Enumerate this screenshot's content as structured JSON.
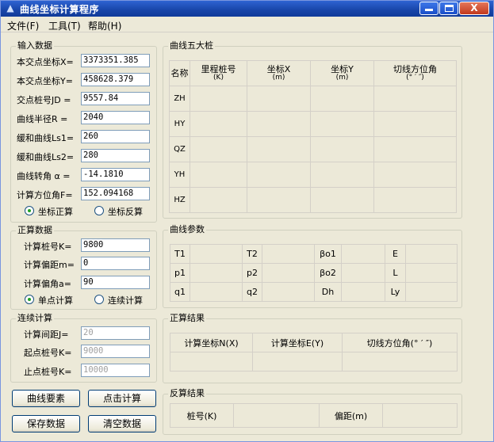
{
  "window": {
    "title": "曲线坐标计算程序",
    "icon": "app-icon",
    "controls": {
      "minimize": "minimize",
      "maximize": "maximize",
      "close": "close",
      "close_glyph": "X"
    }
  },
  "menu": [
    "文件(F)",
    "工具(T)",
    "帮助(H)"
  ],
  "input_group": {
    "title": "输入数据",
    "fields": [
      {
        "label": "本交点坐标X=",
        "value": "3373351.385"
      },
      {
        "label": "本交点坐标Y=",
        "value": "458628.379"
      },
      {
        "label": "交点桩号JD =",
        "value": "9557.84"
      },
      {
        "label": "曲线半径R  =",
        "value": "2040"
      },
      {
        "label": "缓和曲线Ls1=",
        "value": "260"
      },
      {
        "label": "缓和曲线Ls2=",
        "value": "280"
      },
      {
        "label": "曲线转角 α  =",
        "value": "-14.1810"
      },
      {
        "label": "计算方位角F=",
        "value": "152.094168"
      }
    ],
    "mode_options": [
      {
        "label": "坐标正算",
        "checked": true
      },
      {
        "label": "坐标反算",
        "checked": false
      }
    ]
  },
  "forward_group": {
    "title": "正算数据",
    "fields": [
      {
        "label": "计算桩号K=",
        "value": "9800"
      },
      {
        "label": "计算偏距m=",
        "value": "0"
      },
      {
        "label": "计算偏角a=",
        "value": "90"
      }
    ],
    "calc_options": [
      {
        "label": "单点计算",
        "checked": true
      },
      {
        "label": "连续计算",
        "checked": false
      }
    ]
  },
  "continuous_group": {
    "title": "连续计算",
    "fields": [
      {
        "label": "计算间距J=",
        "value": "20"
      },
      {
        "label": "起点桩号K=",
        "value": "9000"
      },
      {
        "label": "止点桩号K=",
        "value": "10000"
      }
    ]
  },
  "buttons": {
    "curve_elements": "曲线要素",
    "click_calc": "点击计算",
    "save_data": "保存数据",
    "clear_data": "清空数据"
  },
  "five_stakes": {
    "title": "曲线五大桩",
    "headers": [
      {
        "main": "名称",
        "sub": ""
      },
      {
        "main": "里程桩号",
        "sub": "(K)"
      },
      {
        "main": "坐标X",
        "sub": "(m)"
      },
      {
        "main": "坐标Y",
        "sub": "(m)"
      },
      {
        "main": "切线方位角",
        "sub": "(° ′ ″)"
      }
    ],
    "rows": [
      "ZH",
      "HY",
      "QZ",
      "YH",
      "HZ"
    ]
  },
  "curve_params": {
    "title": "曲线参数",
    "rows": [
      [
        "T1",
        "",
        "T2",
        "",
        "βo1",
        "",
        "E",
        ""
      ],
      [
        "p1",
        "",
        "p2",
        "",
        "βo2",
        "",
        "L",
        ""
      ],
      [
        "q1",
        "",
        "q2",
        "",
        "Dh",
        "",
        "Ly",
        ""
      ]
    ]
  },
  "forward_result": {
    "title": "正算结果",
    "headers": [
      "计算坐标N(X)",
      "计算坐标E(Y)",
      "切线方位角(° ′ ″)"
    ]
  },
  "inverse_result": {
    "title": "反算结果",
    "headers": [
      "桩号(K)",
      "",
      "偏距(m)",
      ""
    ]
  }
}
